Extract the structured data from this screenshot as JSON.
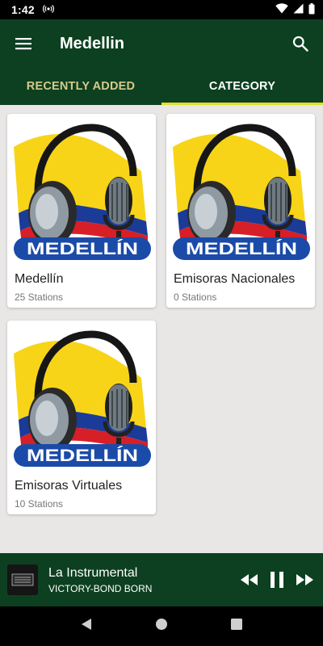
{
  "status_bar": {
    "time": "1:42"
  },
  "app_bar": {
    "title": "Medellin"
  },
  "tabs": [
    {
      "label": "RECENTLY ADDED",
      "active": false
    },
    {
      "label": "CATEGORY",
      "active": true
    }
  ],
  "categories": [
    {
      "name": "Medellín",
      "count": "25 Stations",
      "logo_text": "MEDELLÍN"
    },
    {
      "name": "Emisoras Nacionales",
      "count": "0 Stations",
      "logo_text": "MEDELLÍN"
    },
    {
      "name": "Emisoras Virtuales",
      "count": "10 Stations",
      "logo_text": "MEDELLÍN"
    }
  ],
  "player": {
    "title": "La Instrumental",
    "artist": "VICTORY-BOND BORN"
  },
  "colors": {
    "primary": "#0c4020",
    "tab_indicator": "#e2df2a",
    "inactive_tab": "#d7c98a",
    "flag_yellow": "#f7d417",
    "flag_blue": "#1b3b98",
    "flag_red": "#d61f26"
  }
}
